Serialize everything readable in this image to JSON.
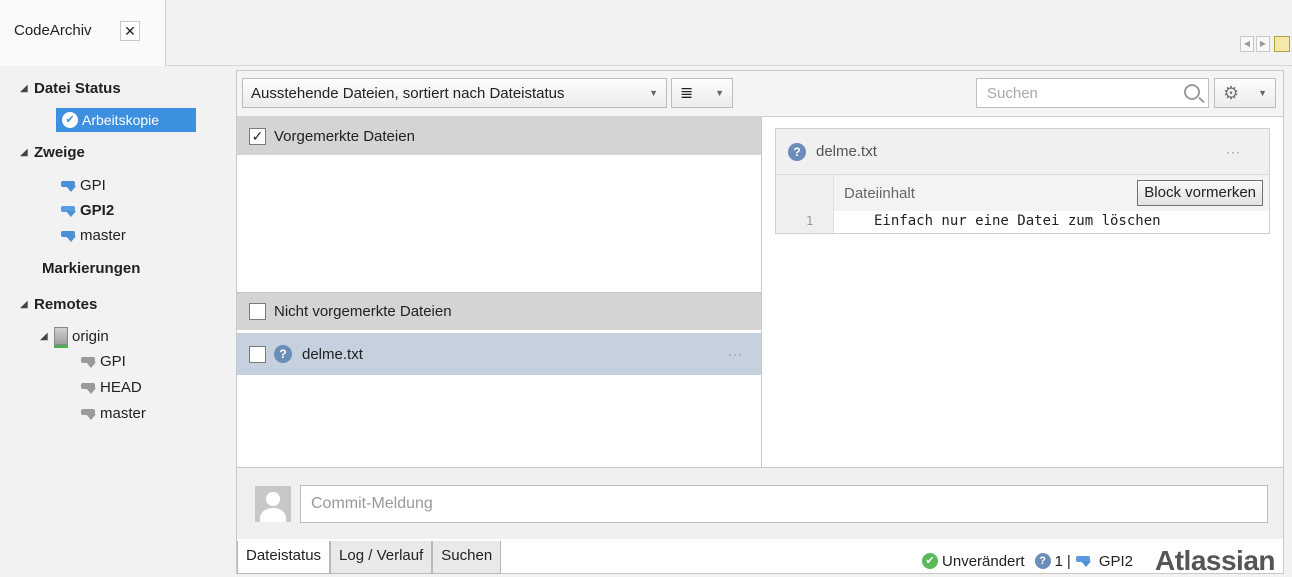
{
  "tabs": {
    "doc_title": "CodeArchiv",
    "close_symbol": "✕"
  },
  "sidebar": {
    "file_status": "Datei Status",
    "working_copy": "Arbeitskopie",
    "branches_header": "Zweige",
    "branches": [
      "GPI",
      "GPI2",
      "master"
    ],
    "tags_header": "Markierungen",
    "remotes_header": "Remotes",
    "remote_name": "origin",
    "remote_branches": [
      "GPI",
      "HEAD",
      "master"
    ]
  },
  "toolbar": {
    "filter_label": "Ausstehende Dateien, sortiert nach Dateistatus",
    "view_icon": "≣",
    "search_placeholder": "Suchen",
    "settings_icon": "⚙"
  },
  "staged": {
    "header": "Vorgemerkte Dateien"
  },
  "unstaged": {
    "header": "Nicht vorgemerkte Dateien",
    "file": "delme.txt"
  },
  "diff": {
    "file": "delme.txt",
    "hunk_label": "Dateiinhalt",
    "stage_block": "Block vormerken",
    "line_number": "1",
    "line_text": "Einfach nur eine Datei zum löschen"
  },
  "commit": {
    "placeholder": "Commit-Meldung"
  },
  "bottom_tabs": [
    "Dateistatus",
    "Log / Verlauf",
    "Suchen"
  ],
  "status": {
    "state": "Unverändert",
    "pending_count": "1",
    "separator": "|",
    "branch": "GPI2",
    "brand": "Atlassian"
  },
  "colors": {
    "selection": "#3d8fe0",
    "row_highlight": "#c5d1de",
    "section_header": "#d4d4d4"
  }
}
